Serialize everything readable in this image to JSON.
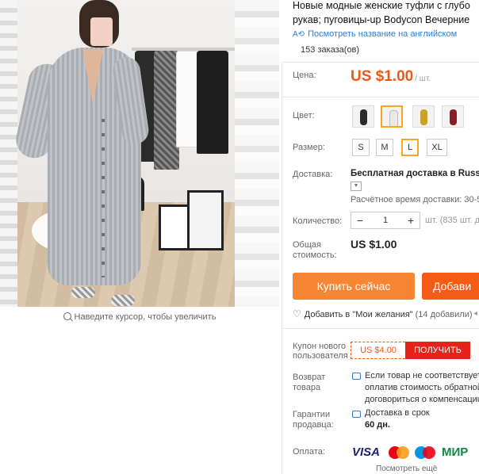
{
  "gallery": {
    "zoom_hint": "Наведите курсор, чтобы увеличить"
  },
  "product": {
    "title_line1": "Новые модные женские туфли с глубо",
    "title_line2": "рукав; пуговицы-up Bodycon Вечерние",
    "translate_link": "Посмотреть название на английском",
    "orders": "153 заказа(ов)"
  },
  "price": {
    "label": "Цена:",
    "value": "US $1.00",
    "unit": "/ шт."
  },
  "color": {
    "label": "Цвет:",
    "swatches": [
      "black",
      "white",
      "mustard",
      "red-black"
    ],
    "selected_index": 1,
    "colors": [
      "#2a2a2a",
      "#f1f1f1",
      "#c9a227",
      "#8b1e24"
    ]
  },
  "size": {
    "label": "Размер:",
    "options": [
      "S",
      "M",
      "L",
      "XL"
    ],
    "selected": "L"
  },
  "shipping": {
    "label": "Доставка:",
    "method": "Бесплатная доставка в Russian",
    "estimate": "Расчётное время доставки: 30-5"
  },
  "quantity": {
    "label": "Количество:",
    "value": "1",
    "minus": "−",
    "plus": "+",
    "available": "шт. (835 шт. д"
  },
  "total": {
    "label_line1": "Общая",
    "label_line2": "стоимость:",
    "value": "US $1.00"
  },
  "actions": {
    "buy_now": "Купить сейчас",
    "add_to_cart": "Добави"
  },
  "wishlist": {
    "label": "Добавить в \"Мои желания\"",
    "count": "(14 добавили)"
  },
  "coupon": {
    "label_line1": "Купон нового",
    "label_line2": "пользователя",
    "amount": "US $4.00",
    "get": "ПОЛУЧИТЬ"
  },
  "returns": {
    "label_line1": "Возврат",
    "label_line2": "товара",
    "text": "Если товар не соответствует оплатив стоимость обратной договориться о компенсации"
  },
  "guarantee": {
    "label_line1": "Гарантии",
    "label_line2": "продавца:",
    "text": "Доставка в срок",
    "days": "60 дн."
  },
  "payment": {
    "label": "Оплата:",
    "visa": "VISA",
    "mir": "МИР",
    "more": "Посмотреть ещё"
  }
}
